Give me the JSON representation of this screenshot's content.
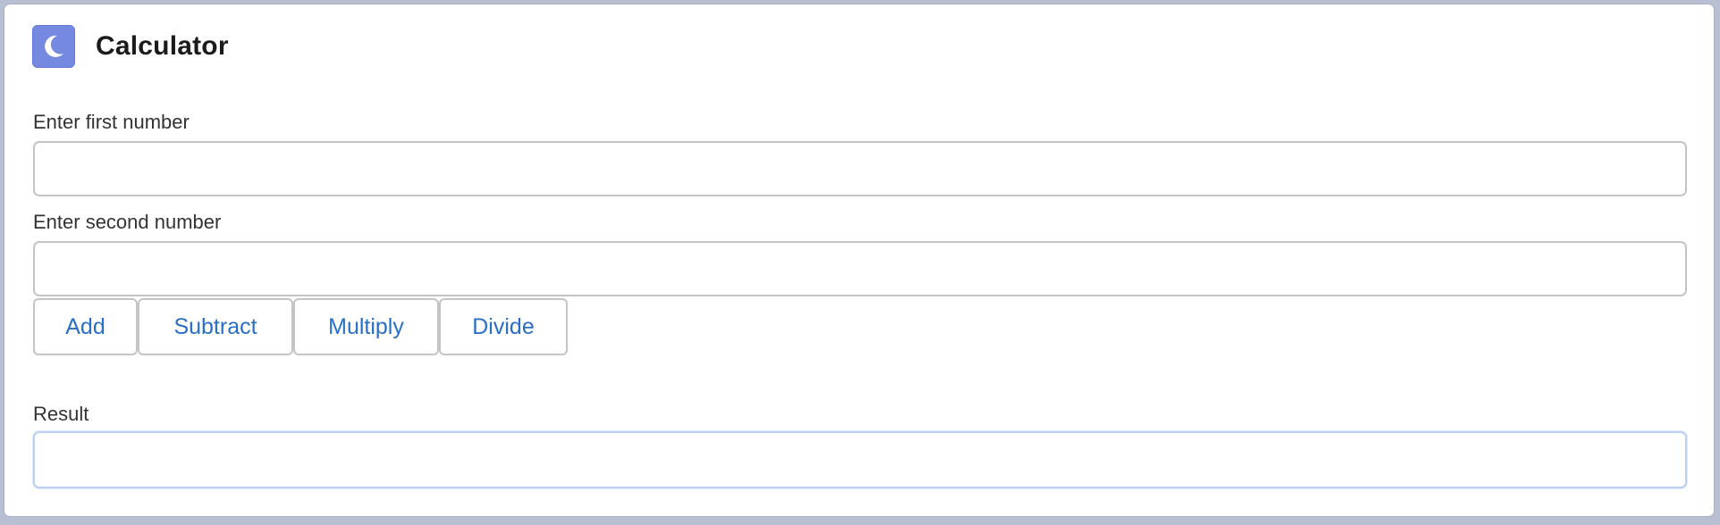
{
  "app": {
    "title": "Calculator",
    "icon": "moon-icon",
    "accent_color": "#7689e0"
  },
  "form": {
    "first": {
      "label": "Enter first number",
      "value": "",
      "placeholder": ""
    },
    "second": {
      "label": "Enter second number",
      "value": "",
      "placeholder": ""
    },
    "buttons": {
      "add": "Add",
      "subtract": "Subtract",
      "multiply": "Multiply",
      "divide": "Divide"
    },
    "result": {
      "label": "Result",
      "value": "",
      "placeholder": ""
    }
  },
  "colors": {
    "link_blue": "#2a6fc6",
    "border_gray": "#c4c4c4",
    "focus_border": "#bcd1ef"
  }
}
